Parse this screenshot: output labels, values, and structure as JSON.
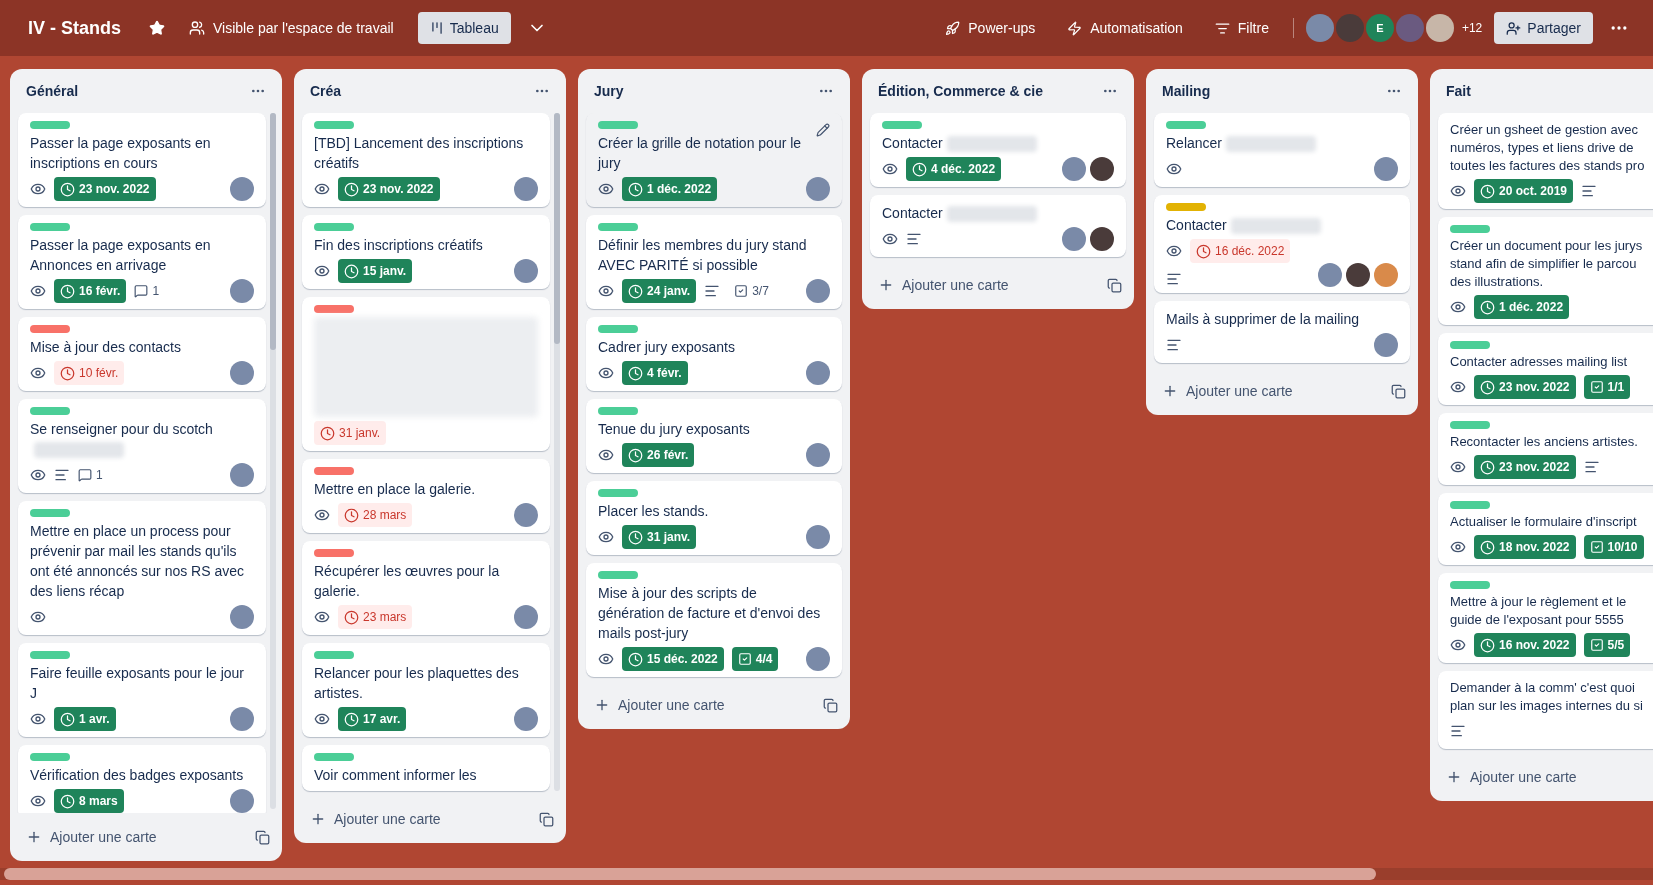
{
  "header": {
    "title": "IV - Stands",
    "starred": true,
    "visibility": "Visible par l'espace de travail",
    "views": [
      {
        "label": "Tableau",
        "selected": true
      }
    ],
    "actions": [
      {
        "kind": "powerups",
        "label": "Power-ups"
      },
      {
        "kind": "automation",
        "label": "Automatisation"
      },
      {
        "kind": "filter",
        "label": "Filtre"
      }
    ],
    "members": [
      {
        "kind": "photo"
      },
      {
        "kind": "photo"
      },
      {
        "kind": "letter",
        "initial": "E"
      },
      {
        "kind": "photo"
      },
      {
        "kind": "photo"
      }
    ],
    "more_members": "+12",
    "share": "Partager"
  },
  "lists": [
    {
      "title": "Général",
      "scrolls": true,
      "cut": false,
      "add": "Ajouter une carte",
      "cards": [
        {
          "color": "#4bce97",
          "title": "Passer la page exposants en inscriptions en cours",
          "badges": [
            {
              "kind": "watch"
            },
            {
              "kind": "date",
              "overdue": false,
              "text": "23 nov. 2022"
            }
          ],
          "members": [
            {
              "kind": "photo"
            }
          ]
        },
        {
          "color": "#4bce97",
          "title": "Passer la page exposants en Annonces en arrivage",
          "badges": [
            {
              "kind": "watch"
            },
            {
              "kind": "date",
              "overdue": false,
              "text": "16 févr."
            },
            {
              "kind": "comments",
              "text": "1"
            }
          ],
          "members": [
            {
              "kind": "photo"
            }
          ]
        },
        {
          "color": "#f87168",
          "title": "Mise à jour des contacts",
          "badges": [
            {
              "kind": "watch"
            },
            {
              "kind": "date",
              "overdue": true,
              "text": "10 févr."
            }
          ],
          "members": [
            {
              "kind": "photo"
            }
          ]
        },
        {
          "color": "#4bce97",
          "title": "Se renseigner pour du scotch",
          "redacted": true,
          "badges": [
            {
              "kind": "watch"
            },
            {
              "kind": "description"
            },
            {
              "kind": "comments",
              "text": "1"
            }
          ],
          "members": [
            {
              "kind": "photo"
            }
          ]
        },
        {
          "color": "#4bce97",
          "title": "Mettre en place un process pour prévenir par mail les stands qu'ils ont été annoncés sur nos RS avec des liens récap",
          "badges": [
            {
              "kind": "watch"
            }
          ],
          "members": [
            {
              "kind": "photo"
            }
          ]
        },
        {
          "color": "#4bce97",
          "title": "Faire feuille exposants pour le jour J",
          "badges": [
            {
              "kind": "watch"
            },
            {
              "kind": "date",
              "overdue": false,
              "text": "1 avr."
            }
          ],
          "members": [
            {
              "kind": "photo"
            }
          ]
        },
        {
          "color": "#4bce97",
          "title": "Vérification des badges exposants",
          "badges": [
            {
              "kind": "watch"
            },
            {
              "kind": "date",
              "overdue": false,
              "text": "8 mars"
            }
          ],
          "members": [
            {
              "kind": "photo"
            }
          ]
        }
      ]
    },
    {
      "title": "Créa",
      "scrolls": true,
      "cut": false,
      "add": "Ajouter une carte",
      "cards": [
        {
          "color": "#4bce97",
          "title": "[TBD] Lancement des inscriptions créatifs",
          "badges": [
            {
              "kind": "watch"
            },
            {
              "kind": "date",
              "overdue": false,
              "text": "23 nov. 2022"
            }
          ],
          "members": [
            {
              "kind": "photo"
            }
          ]
        },
        {
          "color": "#4bce97",
          "title": "Fin des inscriptions créatifs",
          "badges": [
            {
              "kind": "watch"
            },
            {
              "kind": "date",
              "overdue": false,
              "text": "15 janv."
            }
          ],
          "members": [
            {
              "kind": "photo"
            }
          ]
        },
        {
          "color": "#f87168",
          "redacted": true,
          "badges": [
            {
              "kind": "date",
              "overdue": true,
              "text": "31 janv."
            }
          ]
        },
        {
          "color": "#f87168",
          "title": "Mettre en place la galerie.",
          "badges": [
            {
              "kind": "watch"
            },
            {
              "kind": "date",
              "overdue": true,
              "text": "28 mars"
            }
          ],
          "members": [
            {
              "kind": "photo"
            }
          ]
        },
        {
          "color": "#f87168",
          "title": "Récupérer les œuvres pour la galerie.",
          "badges": [
            {
              "kind": "watch"
            },
            {
              "kind": "date",
              "overdue": true,
              "text": "23 mars"
            }
          ],
          "members": [
            {
              "kind": "photo"
            }
          ]
        },
        {
          "color": "#4bce97",
          "title": "Relancer pour les plaquettes des artistes.",
          "badges": [
            {
              "kind": "watch"
            },
            {
              "kind": "date",
              "overdue": false,
              "text": "17 avr."
            }
          ],
          "members": [
            {
              "kind": "photo"
            }
          ]
        },
        {
          "color": "#4bce97",
          "title": "Voir comment informer les"
        }
      ]
    },
    {
      "title": "Jury",
      "scrolls": false,
      "cut": false,
      "add": "Ajouter une carte",
      "cards": [
        {
          "color": "#4bce97",
          "title": "Créer la grille de notation pour le jury",
          "hover": true,
          "badges": [
            {
              "kind": "watch"
            },
            {
              "kind": "date",
              "overdue": false,
              "text": "1 déc. 2022"
            }
          ],
          "members": [
            {
              "kind": "photo"
            }
          ]
        },
        {
          "color": "#4bce97",
          "title": "Définir les membres du jury stand AVEC PARITÉ si possible",
          "badges": [
            {
              "kind": "watch"
            },
            {
              "kind": "date",
              "overdue": false,
              "text": "24 janv."
            },
            {
              "kind": "description"
            },
            {
              "kind": "checklist",
              "complete": false,
              "text": "3/7"
            }
          ],
          "members": [
            {
              "kind": "photo"
            }
          ]
        },
        {
          "color": "#4bce97",
          "title": "Cadrer jury exposants",
          "badges": [
            {
              "kind": "watch"
            },
            {
              "kind": "date",
              "overdue": false,
              "text": "4 févr."
            }
          ],
          "members": [
            {
              "kind": "photo"
            }
          ]
        },
        {
          "color": "#4bce97",
          "title": "Tenue du jury exposants",
          "badges": [
            {
              "kind": "watch"
            },
            {
              "kind": "date",
              "overdue": false,
              "text": "26 févr."
            }
          ],
          "members": [
            {
              "kind": "photo"
            }
          ]
        },
        {
          "color": "#4bce97",
          "title": "Placer les stands.",
          "badges": [
            {
              "kind": "watch"
            },
            {
              "kind": "date",
              "overdue": false,
              "text": "31 janv."
            }
          ],
          "members": [
            {
              "kind": "photo"
            }
          ]
        },
        {
          "color": "#4bce97",
          "title": "Mise à jour des scripts de génération de facture et d'envoi des mails post-jury",
          "badges": [
            {
              "kind": "watch"
            },
            {
              "kind": "date",
              "overdue": false,
              "text": "15 déc. 2022"
            },
            {
              "kind": "checklist",
              "complete": true,
              "text": "4/4"
            }
          ],
          "members": [
            {
              "kind": "photo"
            }
          ]
        }
      ]
    },
    {
      "title": "Édition, Commerce & cie",
      "scrolls": false,
      "cut": false,
      "add": "Ajouter une carte",
      "cards": [
        {
          "color": "#4bce97",
          "title": "Contacter",
          "redacted": true,
          "badges": [
            {
              "kind": "watch"
            },
            {
              "kind": "date",
              "overdue": false,
              "text": "4 déc. 2022"
            }
          ],
          "members": [
            {
              "kind": "photo"
            },
            {
              "kind": "photo"
            }
          ]
        },
        {
          "title": "Contacter",
          "redacted": true,
          "badges": [
            {
              "kind": "watch"
            },
            {
              "kind": "description"
            }
          ],
          "members": [
            {
              "kind": "photo"
            },
            {
              "kind": "photo"
            }
          ]
        }
      ]
    },
    {
      "title": "Mailing",
      "scrolls": false,
      "cut": false,
      "add": "Ajouter une carte",
      "cards": [
        {
          "color": "#4bce97",
          "title": "Relancer",
          "redacted": true,
          "badges": [
            {
              "kind": "watch"
            }
          ],
          "members": [
            {
              "kind": "photo"
            }
          ]
        },
        {
          "color": "#e2b203",
          "title": "Contacter",
          "redacted": true,
          "badges": [
            {
              "kind": "watch"
            },
            {
              "kind": "date",
              "overdue": true,
              "text": "16 déc. 2022"
            },
            {
              "kind": "description"
            }
          ],
          "members": [
            {
              "kind": "photo"
            },
            {
              "kind": "photo"
            },
            {
              "kind": "photo"
            }
          ]
        },
        {
          "title": "Mails à supprimer de la mailing",
          "badges": [
            {
              "kind": "description"
            }
          ],
          "members": [
            {
              "kind": "photo"
            }
          ]
        }
      ]
    },
    {
      "title": "Fait",
      "scrolls": false,
      "cut": true,
      "add": "Ajouter une carte",
      "cards": [
        {
          "title": "Créer un gsheet de gestion avec numéros, types et liens drive de toutes les factures des stands pro",
          "badges": [
            {
              "kind": "watch"
            },
            {
              "kind": "date",
              "overdue": false,
              "text": "20 oct. 2019"
            },
            {
              "kind": "description"
            }
          ]
        },
        {
          "color": "#4bce97",
          "title": "Créer un document pour les jurys stand afin de simplifier le parcou des illustrations.",
          "badges": [
            {
              "kind": "watch"
            },
            {
              "kind": "date",
              "overdue": false,
              "text": "1 déc. 2022"
            }
          ]
        },
        {
          "color": "#4bce97",
          "title": "Contacter adresses mailing list",
          "badges": [
            {
              "kind": "watch"
            },
            {
              "kind": "date",
              "overdue": false,
              "text": "23 nov. 2022"
            },
            {
              "kind": "checklist",
              "complete": true,
              "text": "1/1"
            }
          ]
        },
        {
          "color": "#4bce97",
          "title": "Recontacter les anciens artistes.",
          "badges": [
            {
              "kind": "watch"
            },
            {
              "kind": "date",
              "overdue": false,
              "text": "23 nov. 2022"
            },
            {
              "kind": "description"
            }
          ]
        },
        {
          "color": "#4bce97",
          "title": "Actualiser le formulaire d'inscript",
          "badges": [
            {
              "kind": "watch"
            },
            {
              "kind": "date",
              "overdue": false,
              "text": "18 nov. 2022"
            },
            {
              "kind": "checklist",
              "complete": true,
              "text": "10/10"
            }
          ]
        },
        {
          "color": "#4bce97",
          "title": "Mettre à jour le règlement et le guide de l'exposant pour 5555",
          "badges": [
            {
              "kind": "watch"
            },
            {
              "kind": "date",
              "overdue": false,
              "text": "16 nov. 2022"
            },
            {
              "kind": "checklist",
              "complete": true,
              "text": "5/5"
            }
          ]
        },
        {
          "title": "Demander à la comm' c'est quoi plan sur les images internes du si",
          "badges": [
            {
              "kind": "description"
            }
          ]
        }
      ]
    }
  ]
}
